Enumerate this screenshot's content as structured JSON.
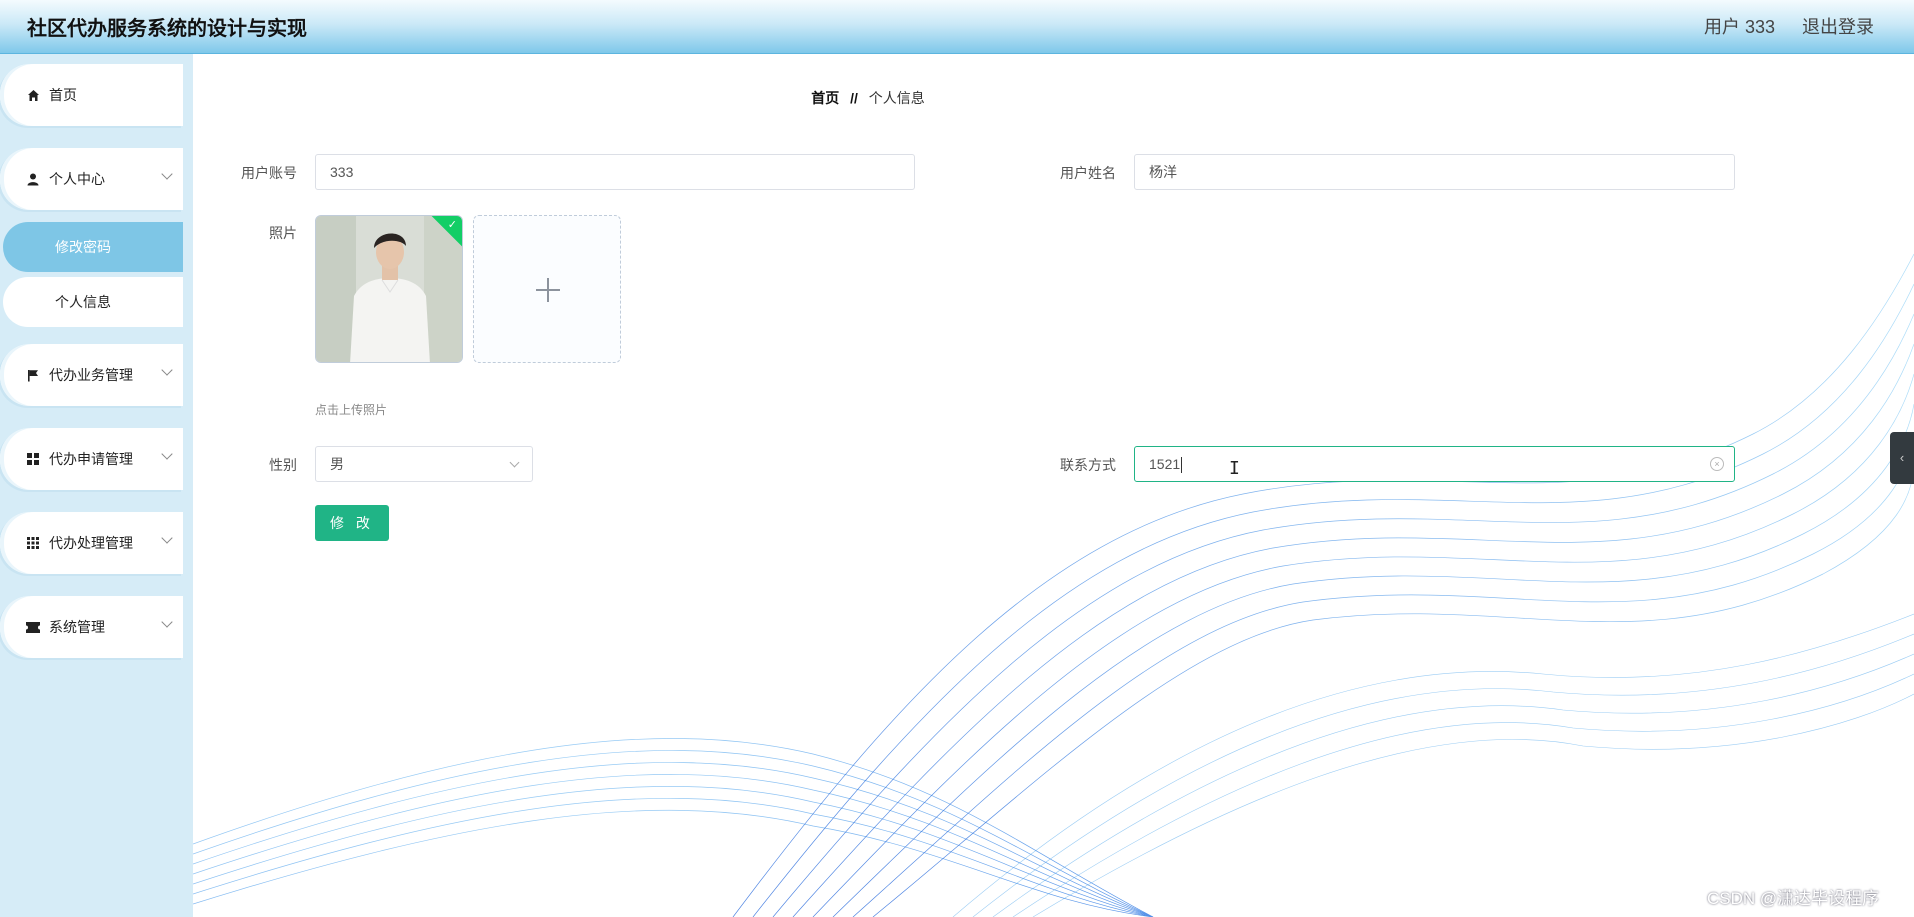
{
  "header": {
    "app_title": "社区代办服务系统的设计与实现",
    "user_label": "用户 333",
    "logout_label": "退出登录"
  },
  "sidebar": {
    "items": [
      {
        "label": "首页",
        "icon": "home-icon"
      },
      {
        "label": "个人中心",
        "icon": "user-icon",
        "expandable": true
      },
      {
        "label": "代办业务管理",
        "icon": "flag-icon",
        "expandable": true
      },
      {
        "label": "代办申请管理",
        "icon": "grid-icon",
        "expandable": true
      },
      {
        "label": "代办处理管理",
        "icon": "apps-icon",
        "expandable": true
      },
      {
        "label": "系统管理",
        "icon": "ticket-icon",
        "expandable": true
      }
    ],
    "sub_items": [
      {
        "label": "修改密码",
        "active": true
      },
      {
        "label": "个人信息",
        "active": false
      }
    ]
  },
  "breadcrumb": {
    "home": "首页",
    "separator": "//",
    "current": "个人信息"
  },
  "form": {
    "account_label": "用户账号",
    "account_value": "333",
    "name_label": "用户姓名",
    "name_value": "杨洋",
    "photo_label": "照片",
    "upload_tip": "点击上传照片",
    "gender_label": "性别",
    "gender_value": "男",
    "contact_label": "联系方式",
    "contact_value": "1521",
    "submit_label": "修 改"
  },
  "colors": {
    "accent": "#20b486",
    "sidebar_bg": "#d6ecf7",
    "active_menu": "#7ec6e6",
    "header_gradient_bottom": "#7fc8ea"
  },
  "watermark": "CSDN @潇达毕设程序"
}
